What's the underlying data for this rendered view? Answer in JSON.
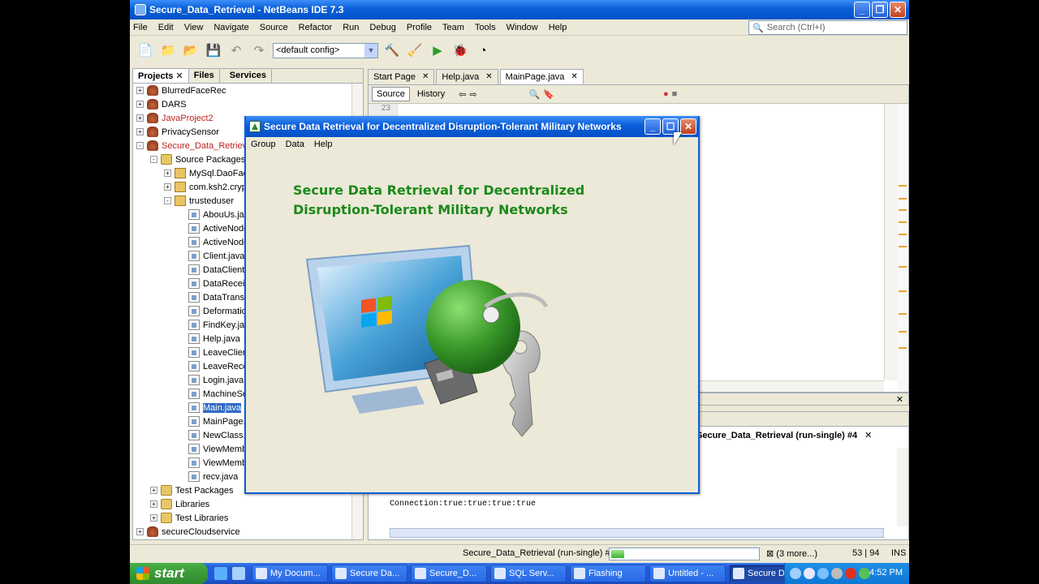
{
  "window": {
    "title": "Secure_Data_Retrieval - NetBeans IDE 7.3"
  },
  "menu": [
    "File",
    "Edit",
    "View",
    "Navigate",
    "Source",
    "Refactor",
    "Run",
    "Debug",
    "Profile",
    "Team",
    "Tools",
    "Window",
    "Help"
  ],
  "search": {
    "placeholder": "Search (Ctrl+I)"
  },
  "toolbar": {
    "config": "<default config>"
  },
  "panel_tabs": [
    "Projects",
    "Files",
    "Services"
  ],
  "tree": [
    {
      "label": "BlurredFaceRec",
      "level": 0,
      "icon": "project",
      "toggle": "+"
    },
    {
      "label": "DARS",
      "level": 0,
      "icon": "project",
      "toggle": "+"
    },
    {
      "label": "JavaProject2",
      "level": 0,
      "icon": "project",
      "toggle": "+",
      "red": true
    },
    {
      "label": "PrivacySensor",
      "level": 0,
      "icon": "project",
      "toggle": "+"
    },
    {
      "label": "Secure_Data_Retrieval",
      "level": 0,
      "icon": "project",
      "toggle": "-",
      "red": true
    },
    {
      "label": "Source Packages",
      "level": 1,
      "icon": "folder",
      "toggle": "-"
    },
    {
      "label": "MySql.DaoFactory",
      "level": 2,
      "icon": "package",
      "toggle": "+"
    },
    {
      "label": "com.ksh2.crypto",
      "level": 2,
      "icon": "package",
      "toggle": "+"
    },
    {
      "label": "trusteduser",
      "level": 2,
      "icon": "package",
      "toggle": "-"
    },
    {
      "label": "AbouUs.java",
      "level": 3,
      "icon": "java"
    },
    {
      "label": "ActiveNode.java",
      "level": 3,
      "icon": "java"
    },
    {
      "label": "ActiveNode1.java",
      "level": 3,
      "icon": "java"
    },
    {
      "label": "Client.java",
      "level": 3,
      "icon": "java"
    },
    {
      "label": "DataClient.java",
      "level": 3,
      "icon": "java"
    },
    {
      "label": "DataReceiver.java",
      "level": 3,
      "icon": "java"
    },
    {
      "label": "DataTransfer.java",
      "level": 3,
      "icon": "java"
    },
    {
      "label": "Deformation.java",
      "level": 3,
      "icon": "java"
    },
    {
      "label": "FindKey.java",
      "level": 3,
      "icon": "java"
    },
    {
      "label": "Help.java",
      "level": 3,
      "icon": "java"
    },
    {
      "label": "LeaveClient.java",
      "level": 3,
      "icon": "java"
    },
    {
      "label": "LeaveReceiver.java",
      "level": 3,
      "icon": "java"
    },
    {
      "label": "Login.java",
      "level": 3,
      "icon": "java"
    },
    {
      "label": "MachineSetup.java",
      "level": 3,
      "icon": "java"
    },
    {
      "label": "Main.java",
      "level": 3,
      "icon": "java",
      "selected": true
    },
    {
      "label": "MainPage.java",
      "level": 3,
      "icon": "java"
    },
    {
      "label": "NewClass.java",
      "level": 3,
      "icon": "java"
    },
    {
      "label": "ViewMember.java",
      "level": 3,
      "icon": "java"
    },
    {
      "label": "ViewMember1.java",
      "level": 3,
      "icon": "java"
    },
    {
      "label": "recv.java",
      "level": 3,
      "icon": "java"
    },
    {
      "label": "Test Packages",
      "level": 1,
      "icon": "folder",
      "toggle": "+"
    },
    {
      "label": "Libraries",
      "level": 1,
      "icon": "folder",
      "toggle": "+"
    },
    {
      "label": "Test Libraries",
      "level": 1,
      "icon": "folder",
      "toggle": "+"
    },
    {
      "label": "secureCloudservice",
      "level": 0,
      "icon": "project",
      "toggle": "+"
    }
  ],
  "editor_tabs": [
    "Start Page",
    "Help.java",
    "MainPage.java"
  ],
  "editor": {
    "source_label": "Source",
    "history_label": "History",
    "line_number": "23"
  },
  "output": {
    "tab_label": "Secure_Data_Retrieval (run-single) #4",
    "line": "Connection:true:true:true:true"
  },
  "status": {
    "task": "Secure_Data_Retrieval (run-single) #4",
    "progress": 0.09,
    "more": "(3 more...)",
    "position": "53 | 94",
    "mode": "INS"
  },
  "dialog": {
    "title": "Secure Data Retrieval for Decentralized Disruption-Tolerant Military Networks",
    "menu": [
      "Group",
      "Data",
      "Help"
    ],
    "heading_line1": "Secure Data Retrieval for Decentralized",
    "heading_line2": "Disruption-Tolerant Military Networks"
  },
  "taskbar": {
    "start_label": "start",
    "tasks": [
      "My Docum...",
      "Secure Da...",
      "Secure_D...",
      "SQL Serv...",
      "Flashing",
      "Untitled - ...",
      "Secure Da..."
    ],
    "active_index": 6,
    "clock": "4:52 PM"
  },
  "colors": {
    "xp_blue": "#0a5fd8",
    "heading_green": "#1a8a1a",
    "selection": "#316ac5"
  }
}
